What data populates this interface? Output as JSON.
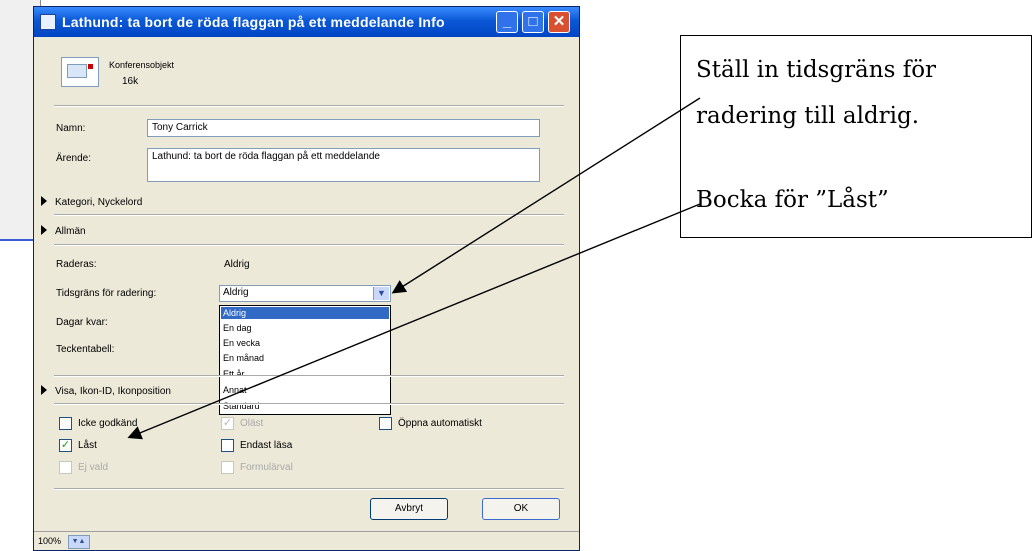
{
  "dialog": {
    "title": "Lathund: ta bort de röda flaggan på ett meddelande Info",
    "window_buttons": {
      "minimize": "_",
      "maximize": "□",
      "close": "✕"
    }
  },
  "attachment": {
    "name": "Konferensobjekt",
    "size": "16k"
  },
  "fields": {
    "name_label": "Namn:",
    "name_value": "Tony Carrick",
    "subject_label": "Ärende:",
    "subject_value": "Lathund: ta bort de röda flaggan på ett meddelande"
  },
  "sections": {
    "category": "Kategori, Nyckelord",
    "general": "Allmän",
    "view": "Visa, Ikon-ID, Ikonposition"
  },
  "general": {
    "deleted_label": "Raderas:",
    "deleted_value": "Aldrig",
    "expire_label": "Tidsgräns för radering:",
    "expire_value": "Aldrig",
    "days_left_label": "Dagar kvar:",
    "charset_label": "Teckentabell:"
  },
  "expire_options": [
    "Aldrig",
    "En dag",
    "En vecka",
    "En månad",
    "Ett år",
    "Annat",
    "Standard"
  ],
  "checkboxes": {
    "not_approved": "Icke godkänd",
    "not_approved_checked": false,
    "unread": "Oläst",
    "unread_checked": true,
    "open_auto": "Öppna automatiskt",
    "open_auto_checked": false,
    "locked": "Låst",
    "locked_checked": true,
    "read_only": "Endast läsa",
    "read_only_checked": false,
    "not_saved": "Ej vald",
    "not_saved_checked": false,
    "form_choice": "Formulärval",
    "form_choice_checked": false
  },
  "buttons": {
    "cancel": "Avbryt",
    "ok": "OK"
  },
  "status": {
    "zoom": "100%"
  },
  "callout": {
    "line1": "Ställ in tidsgräns för",
    "line2": "radering till aldrig.",
    "line3": "Bocka för ”Låst”"
  },
  "colors": {
    "titlebar": "#0a58d6",
    "dialog_bg": "#ece9d8",
    "selection": "#316ac5",
    "check": "#21a121"
  }
}
